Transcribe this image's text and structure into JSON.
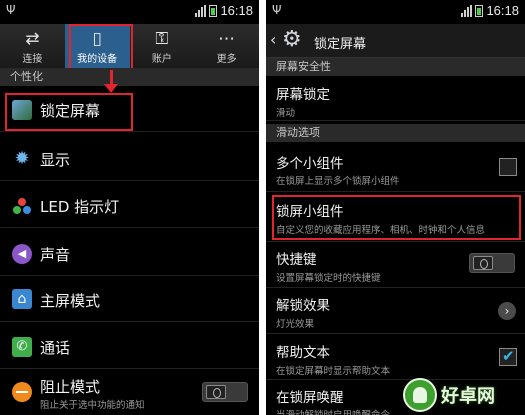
{
  "left": {
    "status": {
      "time": "16:18"
    },
    "tabs": [
      {
        "label": "连接",
        "icon": "connection-icon"
      },
      {
        "label": "我的设备",
        "icon": "device-icon"
      },
      {
        "label": "账户",
        "icon": "key-icon"
      },
      {
        "label": "更多",
        "icon": "more-icon"
      }
    ],
    "section": "个性化",
    "items": [
      {
        "label": "锁定屏幕",
        "icon": "lockscreen-icon"
      },
      {
        "label": "显示",
        "icon": "brightness-icon"
      },
      {
        "label": "LED 指示灯",
        "icon": "led-icon"
      },
      {
        "label": "声音",
        "icon": "sound-icon"
      },
      {
        "label": "主屏模式",
        "icon": "home-icon"
      },
      {
        "label": "通话",
        "icon": "phone-icon"
      },
      {
        "label": "阻止模式",
        "sub": "阻止关于选中功能的通知",
        "icon": "block-icon"
      }
    ]
  },
  "right": {
    "status": {
      "time": "16:18"
    },
    "title": "锁定屏幕",
    "sections": {
      "security": "屏幕安全性",
      "swipe": "滑动选项"
    },
    "items": {
      "screen_lock": {
        "label": "屏幕锁定",
        "sub": "滑动"
      },
      "multi_widgets": {
        "label": "多个小组件",
        "sub": "在锁屏上显示多个锁屏小组件"
      },
      "lock_widgets": {
        "label": "锁屏小组件",
        "sub": "自定义您的收藏应用程序、相机、时钟和个人信息"
      },
      "shortcuts": {
        "label": "快捷键",
        "sub": "设置屏幕锁定时的快捷键"
      },
      "unlock_effect": {
        "label": "解锁效果",
        "sub": "灯光效果"
      },
      "help_text": {
        "label": "帮助文本",
        "sub": "在锁定屏幕时显示帮助文本"
      },
      "wake": {
        "label": "在锁屏唤醒",
        "sub": "当滑动解锁时启用唤醒命令"
      }
    }
  },
  "watermark": {
    "brand": "好卓网"
  },
  "colors": {
    "highlight": "#e0252f",
    "active_tab": "#2b5f8e",
    "check": "#35b8e8"
  }
}
